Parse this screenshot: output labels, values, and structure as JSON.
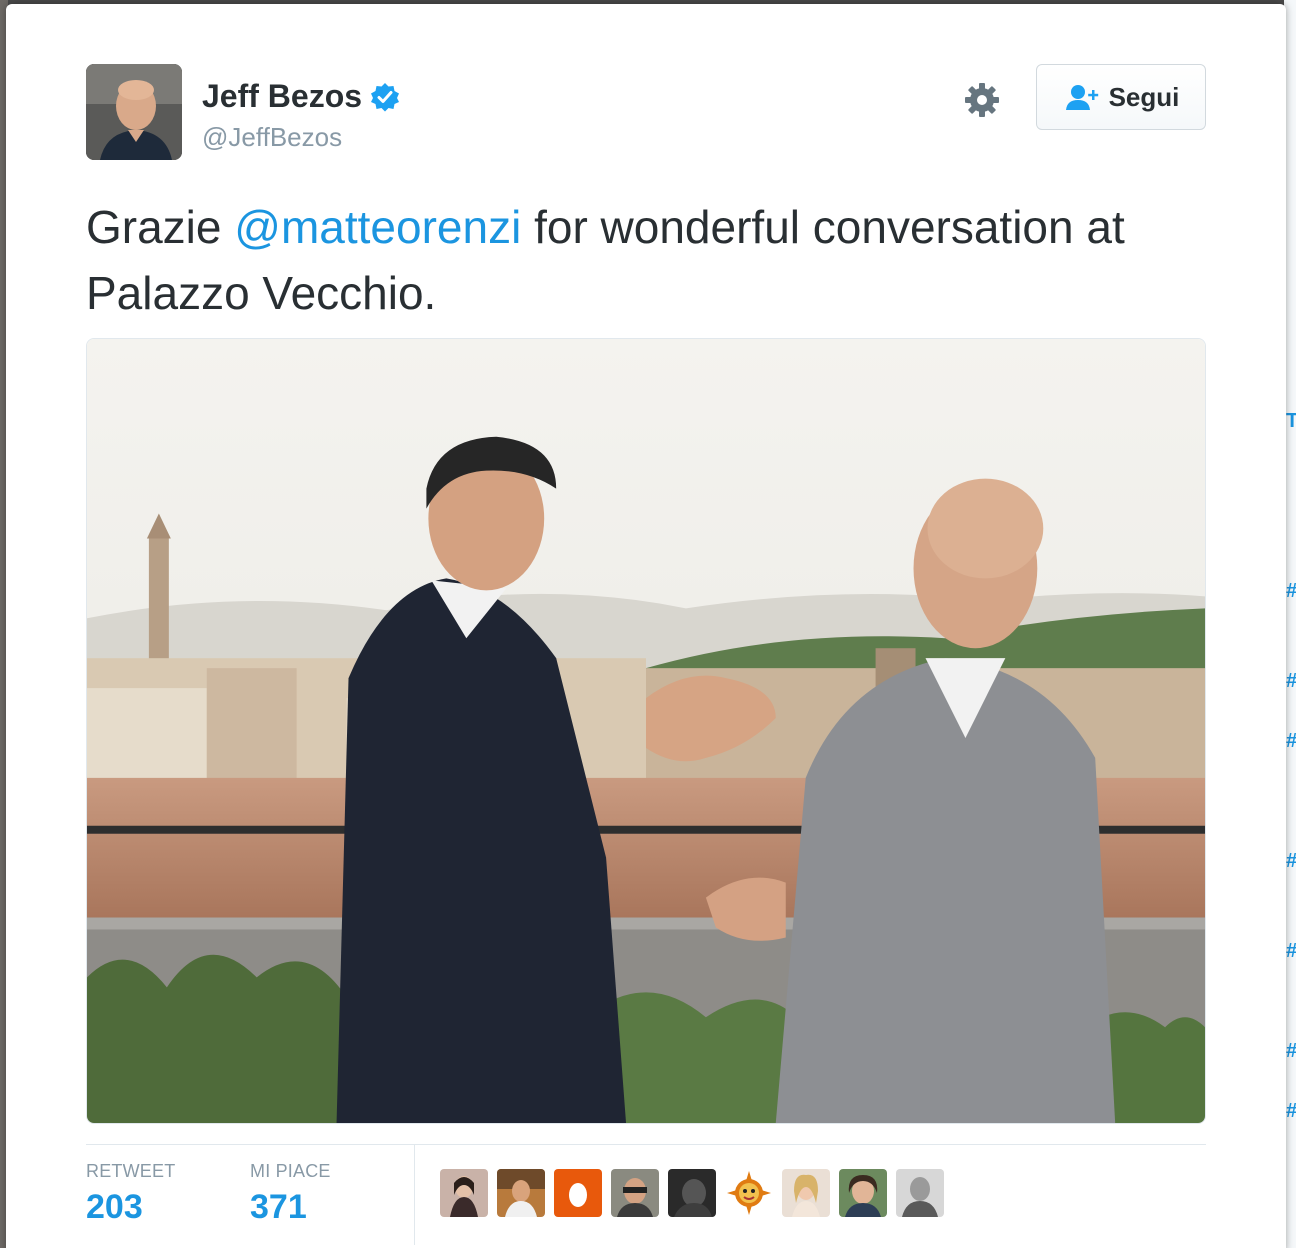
{
  "tweet": {
    "author_name": "Jeff Bezos",
    "author_handle": "@JeffBezos",
    "text_before": "Grazie ",
    "mention": "@matteorenzi",
    "text_after": " for wonderful conversation at Palazzo Vecchio."
  },
  "header": {
    "follow_label": "Segui",
    "icons": [
      "verified-badge-icon",
      "gear-icon",
      "follow-person-plus-icon"
    ]
  },
  "stats": {
    "retweet_label": "RETWEET",
    "retweet_count": "203",
    "likes_label": "MI PIACE",
    "likes_count": "371"
  },
  "colors": {
    "link": "#1b95e0",
    "text": "#292f33",
    "muted": "#8899a6",
    "border": "#e1e8ed"
  }
}
